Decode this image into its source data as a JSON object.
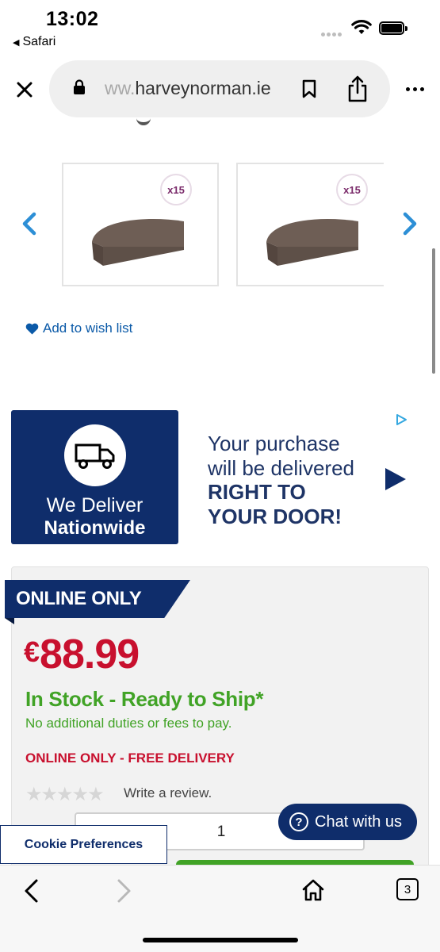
{
  "status": {
    "time": "13:02",
    "back_app": "Safari"
  },
  "browser": {
    "url_faded": "ww.",
    "url_main": "harveynorman.ie",
    "tab_count": "3"
  },
  "gallery": {
    "thumbs": [
      {
        "badge": "x15",
        "icon": "stair-tread-image"
      },
      {
        "badge": "x15",
        "icon": "stair-tread-image"
      }
    ],
    "wishlist_label": "Add to wish list"
  },
  "ad": {
    "left_line1": "We Deliver",
    "left_line2": "Nationwide",
    "right_line1": "Your purchase",
    "right_line2": "will be delivered",
    "right_line3": "RIGHT TO",
    "right_line4": "YOUR DOOR!"
  },
  "product": {
    "tag": "ONLINE ONLY",
    "currency": "€",
    "price": "88.99",
    "stock": "In Stock - Ready to Ship*",
    "duties": "No additional duties or fees to pay.",
    "delivery": "ONLINE ONLY - FREE DELIVERY",
    "rating_stars": "★★★★★",
    "rating": 0,
    "review_label": "Write a review.",
    "quantity": "1"
  },
  "chat": {
    "label": "Chat with us",
    "icon": "question-icon"
  },
  "cookie": {
    "label": "Cookie Preferences"
  },
  "colors": {
    "brand_navy": "#0f2d6b",
    "price_red": "#c8102e",
    "stock_green": "#41a326",
    "link_blue": "#0b5aa8"
  }
}
